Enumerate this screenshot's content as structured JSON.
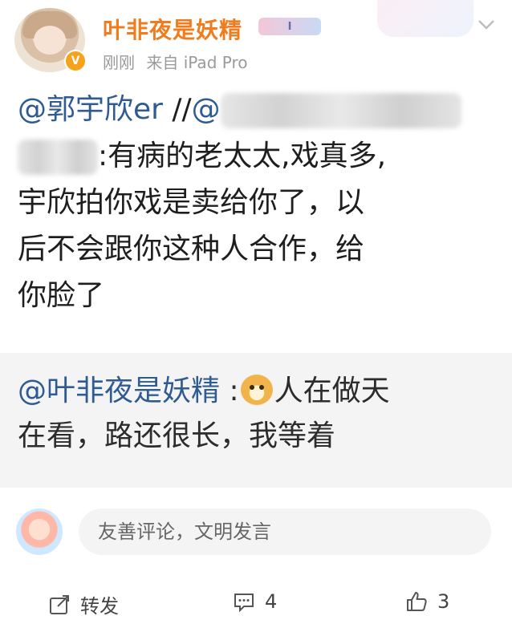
{
  "post": {
    "username": "叶非夜是妖精",
    "level_badge": "I",
    "time": "刚刚",
    "source": "来自 iPad Pro",
    "mention": "@郭宇欣er",
    "repost_sep": "//",
    "repost_at_fragment": "@",
    "line2_tail": ":有病的老太太,戏真多,",
    "line3": "宇欣拍你戏是卖给你了，以",
    "line4": "后不会跟你这种人合作，给",
    "line5": "你脸了"
  },
  "quote": {
    "mention": "@叶非夜是妖精",
    "colon": " :",
    "text_line1_tail": "人在做天",
    "text_line2": "在看，路还很长，我等着"
  },
  "comment": {
    "placeholder": "友善评论，文明发言"
  },
  "footer": {
    "repost_label": "转发",
    "comment_count": "4",
    "like_count": "3"
  }
}
